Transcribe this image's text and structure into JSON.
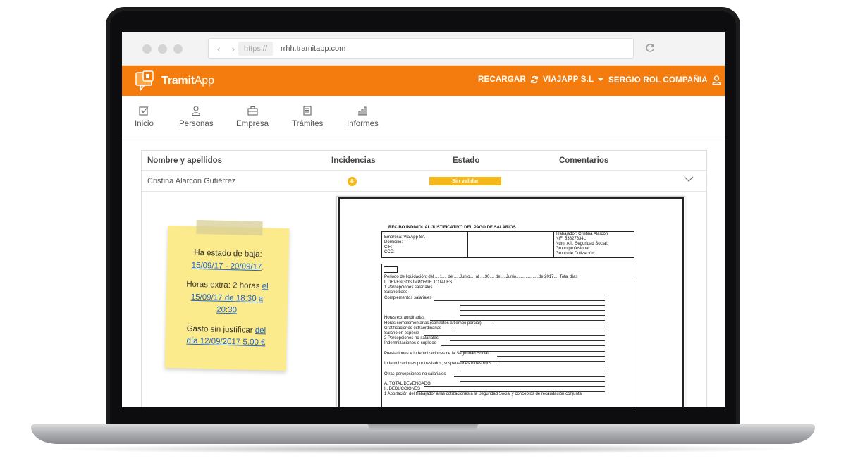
{
  "browser": {
    "protocol": "https://",
    "url": "rrhh.tramitapp.com"
  },
  "app": {
    "logo_bold": "Tramit",
    "logo_light": "App",
    "brand_color": "#f47b0e",
    "header": {
      "reload_label": "RECARGAR",
      "company_label": "VIAJAPP S.L",
      "user_label": "SERGIO ROL COMPAÑIA"
    }
  },
  "nav": {
    "tabs": [
      {
        "label": "Inicio",
        "icon": "check-square-icon"
      },
      {
        "label": "Personas",
        "icon": "person-icon"
      },
      {
        "label": "Empresa",
        "icon": "briefcase-icon"
      },
      {
        "label": "Trámites",
        "icon": "document-icon"
      },
      {
        "label": "Informes",
        "icon": "bar-chart-icon"
      }
    ]
  },
  "table": {
    "columns": [
      "Nombre y apellidos",
      "Incidencias",
      "Estado",
      "Comentarios"
    ],
    "rows": [
      {
        "name": "Cristina Alarcón Gutiérrez",
        "incidencias": "6",
        "estado": "Sin validar"
      }
    ],
    "status_color": "#f5b71a"
  },
  "sticky_note": {
    "baja_text": "Ha estado de baja:",
    "baja_link": "15/09/17 - 20/09/17",
    "baja_suffix": ".",
    "horas_text": "Horas extra: 2 horas",
    "horas_link_1": "el",
    "horas_link_2": "15/09/17 de 18:30 a",
    "horas_link_3": "20:30",
    "gasto_text": "Gasto sin justificar",
    "gasto_link_1": "del",
    "gasto_link_2": "día 12/09/2017 5.00 €"
  },
  "document": {
    "title": "RECIBO INDIVIDUAL JUSTIFICATIVO DEL PAGO DE SALARIOS",
    "empresa_lines": [
      "Empresa: ViajApp SA",
      "Domicilio:",
      "CIF:",
      "CCC:"
    ],
    "trabajador_lines": [
      "Trabajador: Cristina Alarcón",
      "NIF: 53627634L",
      "Núm. Afil. Seguridad Social:",
      "Grupo profesional:",
      "Grupo de Cotización:"
    ],
    "periodo": "Periodo de liquidación: del ....1.... de .....Junio.... al ....30.... de.....Junio...................de 2017.... Total días",
    "lines": [
      "I. DEVENGOS IMPORTE TOTALES",
      "1   Percepciones salariales",
      "Salario base",
      "Complementos salariales",
      "",
      "",
      "",
      "Horas extraordinarias",
      "Horas complementarias (contratos a tiempo parcial)",
      "Gratificaciones extraordinarias",
      "Salario en especie",
      "2   Percepciones no salariales",
      "Indemnizaciones o suplidos",
      "",
      "Prestaciones e indemnizaciones de la Seguridad Social",
      "",
      "Indemnizaciones por traslados, suspensiones o despidos",
      "",
      "Otras percepciones no salariales",
      "",
      "A. TOTAL DEVENGADO",
      "II. DEDUCCIONES",
      "1   Aportación del trabajador a las cotizaciones a la Seguridad Social y conceptos de recaudación conjunta"
    ]
  }
}
